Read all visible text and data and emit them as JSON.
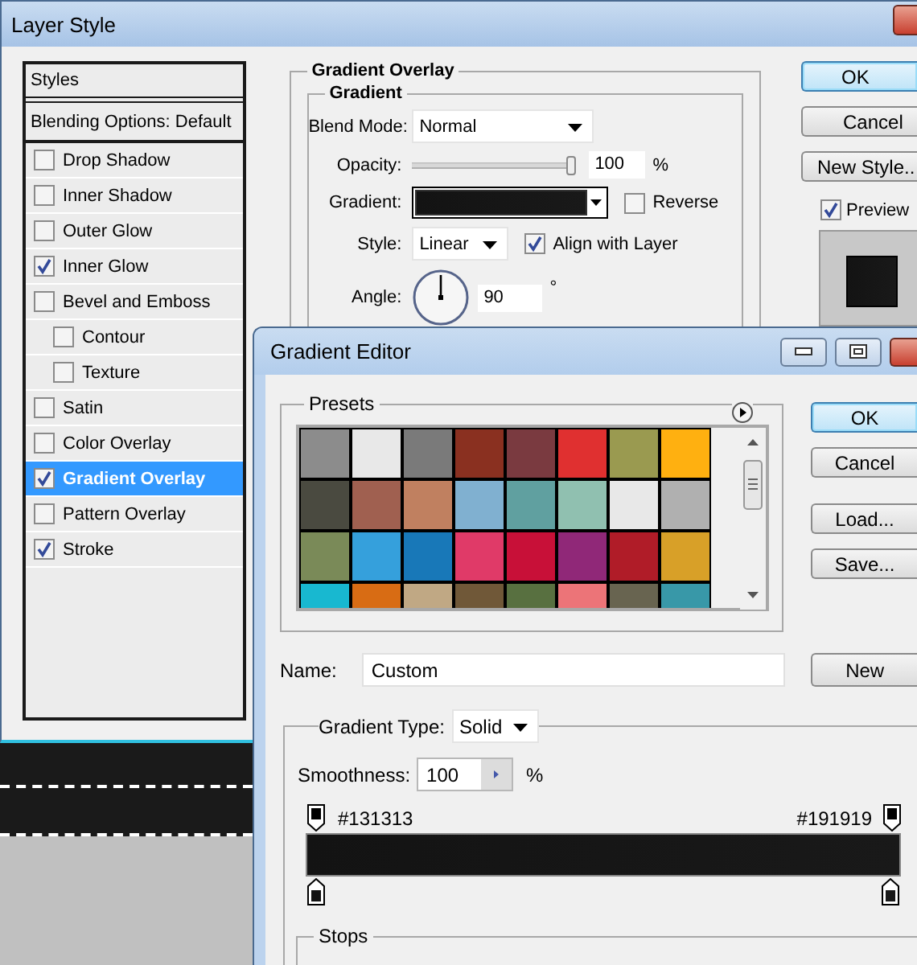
{
  "layer_style": {
    "title": "Layer Style",
    "styles_list": [
      {
        "label": "Styles",
        "kind": "header",
        "selected": false
      },
      {
        "label": "Blending Options: Default",
        "kind": "header",
        "selected": false
      },
      {
        "label": "Drop Shadow",
        "kind": "effect",
        "checked": false,
        "selected": false
      },
      {
        "label": "Inner Shadow",
        "kind": "effect",
        "checked": false,
        "selected": false
      },
      {
        "label": "Outer Glow",
        "kind": "effect",
        "checked": false,
        "selected": false
      },
      {
        "label": "Inner Glow",
        "kind": "effect",
        "checked": true,
        "selected": false
      },
      {
        "label": "Bevel and Emboss",
        "kind": "effect",
        "checked": false,
        "selected": false,
        "children": [
          {
            "label": "Contour",
            "kind": "effect",
            "checked": false,
            "selected": false
          },
          {
            "label": "Texture",
            "kind": "effect",
            "checked": false,
            "selected": false
          }
        ]
      },
      {
        "label": "Satin",
        "kind": "effect",
        "checked": false,
        "selected": false
      },
      {
        "label": "Color Overlay",
        "kind": "effect",
        "checked": false,
        "selected": false
      },
      {
        "label": "Gradient Overlay",
        "kind": "effect",
        "checked": true,
        "selected": true
      },
      {
        "label": "Pattern Overlay",
        "kind": "effect",
        "checked": false,
        "selected": false
      },
      {
        "label": "Stroke",
        "kind": "effect",
        "checked": true,
        "selected": false
      }
    ],
    "gradient_overlay": {
      "title": "Gradient Overlay",
      "group_title": "Gradient",
      "blend_mode": {
        "label": "Blend Mode:",
        "value": "Normal"
      },
      "opacity": {
        "label": "Opacity:",
        "level": 1,
        "value": "100",
        "unit": "%"
      },
      "gradient": {
        "label": "Gradient:"
      },
      "reverse": {
        "label": "Reverse",
        "checked": false
      },
      "style": {
        "label": "Style:",
        "value": "Linear"
      },
      "align_with_layer": {
        "label": "Align with Layer",
        "checked": true
      },
      "angle": {
        "label": "Angle:",
        "value": "90",
        "unit": "°"
      }
    },
    "buttons": [
      {
        "label": "OK",
        "default": true
      },
      {
        "label": "Cancel",
        "default": false
      },
      {
        "label": "New Style..",
        "default": false
      }
    ],
    "preview": {
      "label": "Preview",
      "checked": true
    }
  },
  "gradient_editor": {
    "title": "Gradient Editor",
    "presets_title": "Presets",
    "presets": [
      {
        "color": "#8c8c8c"
      },
      {
        "color": "#e8e8e8"
      },
      {
        "color": "#7a7a7a"
      },
      {
        "color": "#8a3020"
      },
      {
        "color": "#7a3a40"
      },
      {
        "color": "#e03030"
      },
      {
        "color": "#9a9a50"
      },
      {
        "color": "#ffb010"
      },
      {
        "color": "#4a4a40"
      },
      {
        "color": "#a06050"
      },
      {
        "color": "#c08060"
      },
      {
        "color": "#80b0d0"
      },
      {
        "color": "#60a0a0"
      },
      {
        "color": "#90c0b0"
      },
      {
        "color": "#e8e8e8"
      },
      {
        "color": "#b0b0b0"
      },
      {
        "color": "#7a8a58"
      },
      {
        "color": "#35a0dc"
      },
      {
        "color": "#1878b8"
      },
      {
        "color": "#e03a68"
      },
      {
        "color": "#c81038"
      },
      {
        "color": "#902878"
      },
      {
        "color": "#b01c28"
      },
      {
        "color": "#d8a028"
      },
      {
        "color": "#18b8d0"
      },
      {
        "color": "#d86c14"
      },
      {
        "color": "#c0a884"
      },
      {
        "color": "#705838"
      },
      {
        "color": "#587040"
      },
      {
        "color": "#ec7478"
      },
      {
        "color": "#686450"
      },
      {
        "color": "#3898a8"
      }
    ],
    "buttons": [
      {
        "label": "OK",
        "default": true
      },
      {
        "label": "Cancel",
        "default": false
      },
      {
        "label": "Load...",
        "default": false
      },
      {
        "label": "Save...",
        "default": false
      }
    ],
    "name": {
      "label": "Name:",
      "value": "Custom"
    },
    "new_button": "New",
    "gradient_type": {
      "label": "Gradient Type:",
      "value": "Solid"
    },
    "smoothness": {
      "label": "Smoothness:",
      "value": "100",
      "unit": "%"
    },
    "stops": [
      {
        "label": "#131313"
      },
      {
        "label": "#191919"
      }
    ],
    "stops_title": "Stops"
  }
}
